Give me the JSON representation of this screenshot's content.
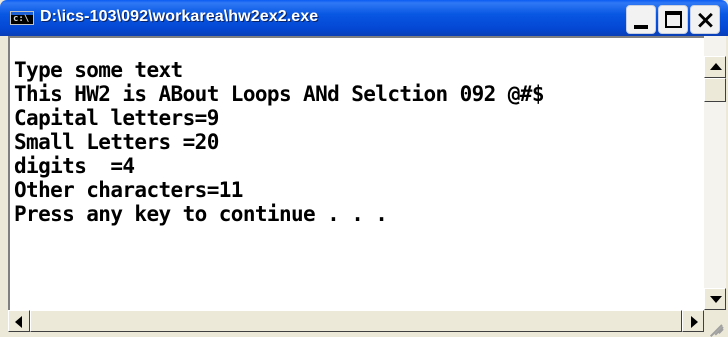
{
  "window": {
    "title": "D:\\ics-103\\092\\workarea\\hw2ex2.exe",
    "icon": "console-icon",
    "controls": {
      "minimize": "minimize-icon",
      "maximize": "maximize-icon",
      "close_glyph": "×"
    }
  },
  "console": {
    "lines": [
      "Type some text",
      "This HW2 is ABout Loops ANd Selction 092 @#$",
      "Capital letters=9",
      "Small Letters =20",
      "digits  =4",
      "Other characters=11",
      "Press any key to continue . . ."
    ]
  },
  "colors": {
    "titlebar": "#0a5cf3",
    "console_bg": "#ffffff",
    "console_text": "#000000",
    "frame": "#ece9d8"
  }
}
